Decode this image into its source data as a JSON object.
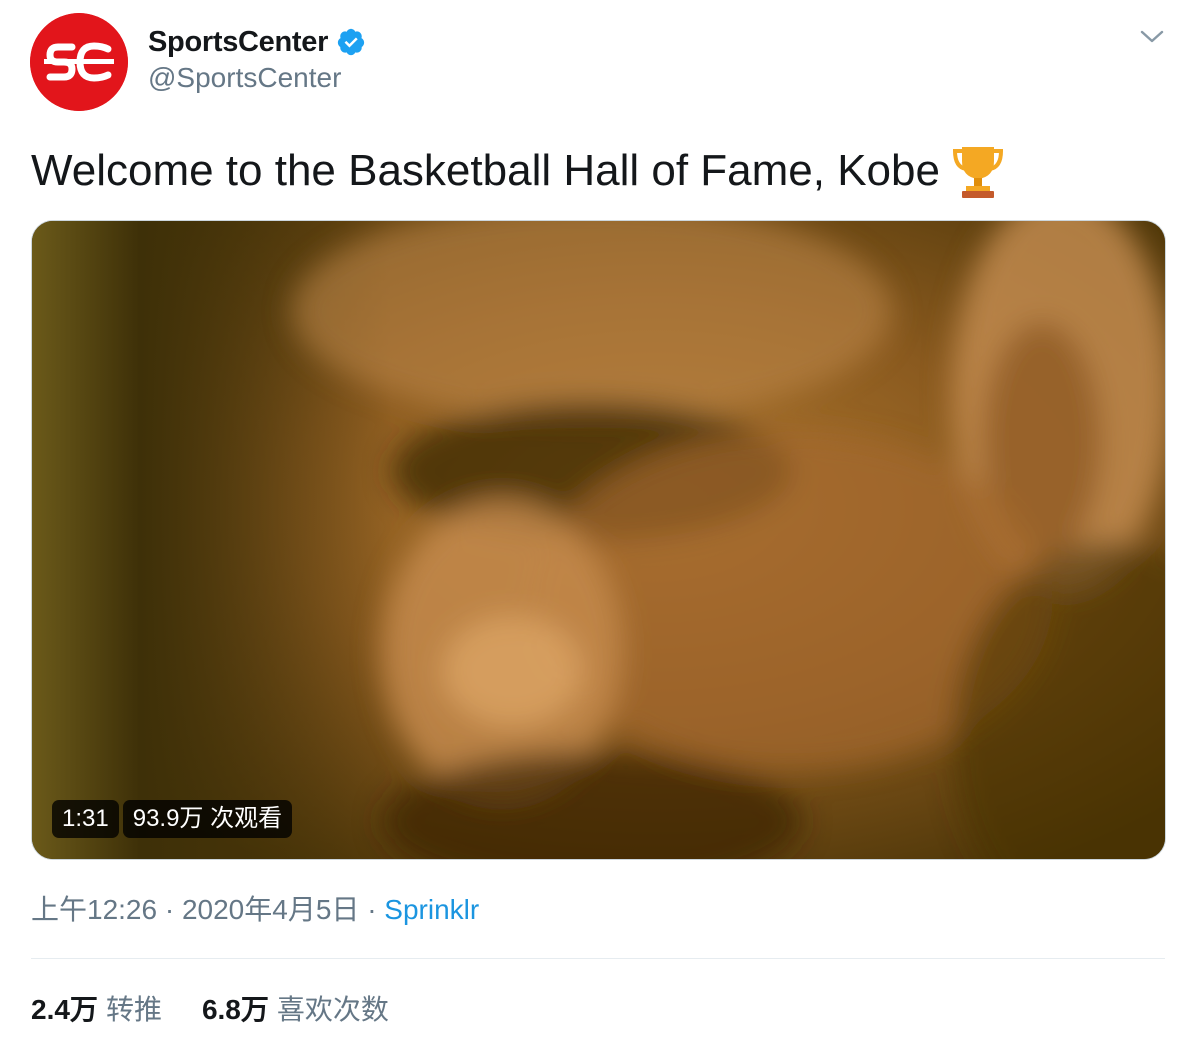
{
  "tweet": {
    "author": {
      "display_name": "SportsCenter",
      "handle": "@SportsCenter",
      "avatar_icon": "sportscenter-logo",
      "avatar_text": "SC",
      "verified": true
    },
    "text": "Welcome to the Basketball Hall of Fame, Kobe",
    "emoji_icon": "trophy-icon",
    "video": {
      "duration": "1:31",
      "views": "93.9万 次观看"
    },
    "meta": {
      "time": "上午12:26",
      "separator": "·",
      "date": "2020年4月5日",
      "source": "Sprinklr"
    },
    "stats": [
      {
        "count": "2.4万",
        "label": "转推"
      },
      {
        "count": "6.8万",
        "label": "喜欢次数"
      }
    ]
  },
  "colors": {
    "brand_red": "#e2151b",
    "verified_blue": "#1da1f2",
    "link_blue": "#1b95e0",
    "secondary_text": "#657786"
  }
}
